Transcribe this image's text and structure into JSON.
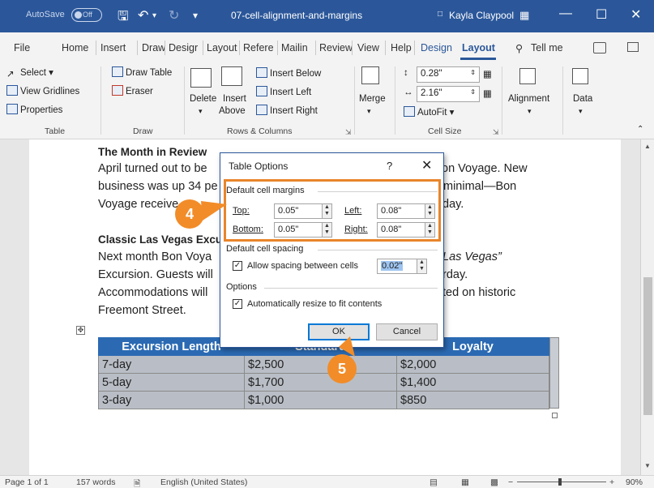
{
  "titlebar": {
    "autosave_label": "AutoSave",
    "autosave_state": "Off",
    "document_title": "07-cell-alignment-and-margins",
    "user_name": "Kayla Claypool"
  },
  "tabs": [
    "File",
    "Home",
    "Insert",
    "Draw",
    "Design",
    "Layout",
    "References",
    "Mailings",
    "Review",
    "View",
    "Help",
    "Design",
    "Layout"
  ],
  "tab_labels_visible": {
    "file": "File",
    "home": "Home",
    "insert": "Insert",
    "draw": "Draw",
    "design": "Desigr",
    "layout": "Layout",
    "references": "Refere",
    "mailings": "Mailin",
    "review": "Review",
    "view": "View",
    "help": "Help",
    "table_design": "Design",
    "table_layout": "Layout",
    "tell_me": "Tell me"
  },
  "ribbon": {
    "table_group": {
      "select": "Select",
      "view_gridlines": "View Gridlines",
      "properties": "Properties",
      "label": "Table"
    },
    "draw_group": {
      "draw_table": "Draw Table",
      "eraser": "Eraser",
      "label": "Draw"
    },
    "rows_columns_group": {
      "delete": "Delete",
      "insert_above_1": "Insert",
      "insert_above_2": "Above",
      "insert_below": "Insert Below",
      "insert_left": "Insert Left",
      "insert_right": "Insert Right",
      "label": "Rows & Columns"
    },
    "merge_group": {
      "merge": "Merge"
    },
    "cell_size_group": {
      "height": "0.28\"",
      "width": "2.16\"",
      "autofit": "AutoFit",
      "label": "Cell Size"
    },
    "alignment": "Alignment",
    "data": "Data"
  },
  "document": {
    "heading1": "The Month in Review",
    "p1_line1_left": "April turned out to be",
    "p1_line1_right": "on Voyage. New",
    "p1_line2_left": "business was up 34 pe",
    "p1_line2_right": "minimal—Bon",
    "p1_line3_left": "Voyage receive",
    "p1_line3_right": "day.",
    "heading2": "Classic Las Vegas Excu",
    "p2_line1_left": "Next month Bon Voya",
    "p2_line1_right": "Las Vegas”",
    "p2_line2_left": "Excursion. Guests will",
    "p2_line2_right": "rday.",
    "p2_line3_left": "Accommodations will",
    "p2_line3_right": "ted on historic",
    "p2_line4": "Freemont Street."
  },
  "table": {
    "headers": [
      "Excursion Length",
      "Standard",
      "Loyalty"
    ],
    "rows": [
      [
        "7-day",
        "$2,500",
        "$2,000"
      ],
      [
        "5-day",
        "$1,700",
        "$1,400"
      ],
      [
        "3-day",
        "$1,000",
        "$850"
      ]
    ]
  },
  "dialog": {
    "title": "Table Options",
    "help": "?",
    "close": "✕",
    "margins_section": "Default cell margins",
    "top_label": "Top:",
    "top_value": "0.05\"",
    "left_label": "Left:",
    "left_value": "0.08\"",
    "bottom_label": "Bottom:",
    "bottom_value": "0.05\"",
    "right_label": "Right:",
    "right_value": "0.08\"",
    "spacing_section": "Default cell spacing",
    "allow_spacing_label": "Allow spacing between cells",
    "spacing_value": "0.02\"",
    "options_section": "Options",
    "auto_resize_label": "Automatically resize to fit contents",
    "ok": "OK",
    "cancel": "Cancel"
  },
  "callouts": {
    "step4": "4",
    "step5": "5"
  },
  "statusbar": {
    "page": "Page 1 of 1",
    "words": "157 words",
    "language": "English (United States)",
    "zoom": "90%",
    "zoom_minus": "−",
    "zoom_plus": "+"
  },
  "colors": {
    "word_blue": "#2b579a",
    "callout_orange": "#f28c28",
    "table_header": "#2b6ab3",
    "table_body": "#b9bec6"
  }
}
